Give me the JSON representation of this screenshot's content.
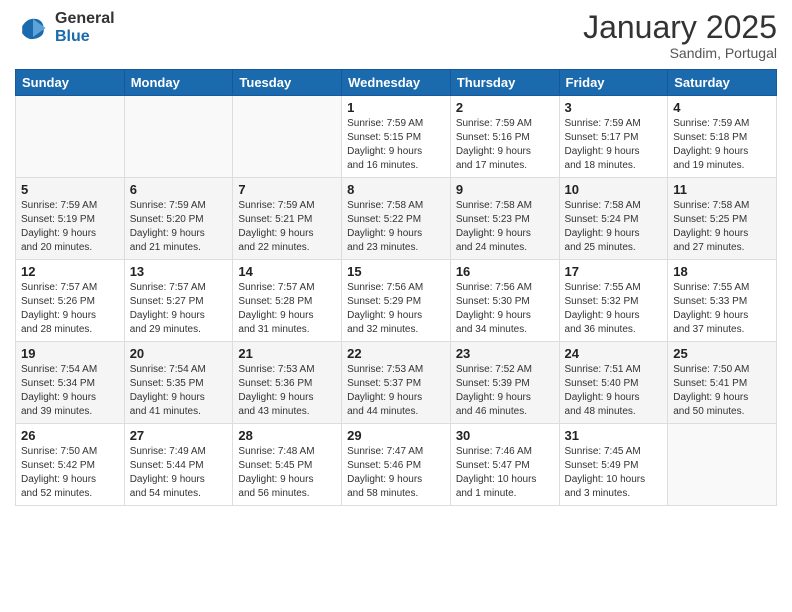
{
  "logo": {
    "general": "General",
    "blue": "Blue"
  },
  "header": {
    "month": "January 2025",
    "location": "Sandim, Portugal"
  },
  "weekdays": [
    "Sunday",
    "Monday",
    "Tuesday",
    "Wednesday",
    "Thursday",
    "Friday",
    "Saturday"
  ],
  "weeks": [
    [
      {
        "day": "",
        "info": ""
      },
      {
        "day": "",
        "info": ""
      },
      {
        "day": "",
        "info": ""
      },
      {
        "day": "1",
        "info": "Sunrise: 7:59 AM\nSunset: 5:15 PM\nDaylight: 9 hours\nand 16 minutes."
      },
      {
        "day": "2",
        "info": "Sunrise: 7:59 AM\nSunset: 5:16 PM\nDaylight: 9 hours\nand 17 minutes."
      },
      {
        "day": "3",
        "info": "Sunrise: 7:59 AM\nSunset: 5:17 PM\nDaylight: 9 hours\nand 18 minutes."
      },
      {
        "day": "4",
        "info": "Sunrise: 7:59 AM\nSunset: 5:18 PM\nDaylight: 9 hours\nand 19 minutes."
      }
    ],
    [
      {
        "day": "5",
        "info": "Sunrise: 7:59 AM\nSunset: 5:19 PM\nDaylight: 9 hours\nand 20 minutes."
      },
      {
        "day": "6",
        "info": "Sunrise: 7:59 AM\nSunset: 5:20 PM\nDaylight: 9 hours\nand 21 minutes."
      },
      {
        "day": "7",
        "info": "Sunrise: 7:59 AM\nSunset: 5:21 PM\nDaylight: 9 hours\nand 22 minutes."
      },
      {
        "day": "8",
        "info": "Sunrise: 7:58 AM\nSunset: 5:22 PM\nDaylight: 9 hours\nand 23 minutes."
      },
      {
        "day": "9",
        "info": "Sunrise: 7:58 AM\nSunset: 5:23 PM\nDaylight: 9 hours\nand 24 minutes."
      },
      {
        "day": "10",
        "info": "Sunrise: 7:58 AM\nSunset: 5:24 PM\nDaylight: 9 hours\nand 25 minutes."
      },
      {
        "day": "11",
        "info": "Sunrise: 7:58 AM\nSunset: 5:25 PM\nDaylight: 9 hours\nand 27 minutes."
      }
    ],
    [
      {
        "day": "12",
        "info": "Sunrise: 7:57 AM\nSunset: 5:26 PM\nDaylight: 9 hours\nand 28 minutes."
      },
      {
        "day": "13",
        "info": "Sunrise: 7:57 AM\nSunset: 5:27 PM\nDaylight: 9 hours\nand 29 minutes."
      },
      {
        "day": "14",
        "info": "Sunrise: 7:57 AM\nSunset: 5:28 PM\nDaylight: 9 hours\nand 31 minutes."
      },
      {
        "day": "15",
        "info": "Sunrise: 7:56 AM\nSunset: 5:29 PM\nDaylight: 9 hours\nand 32 minutes."
      },
      {
        "day": "16",
        "info": "Sunrise: 7:56 AM\nSunset: 5:30 PM\nDaylight: 9 hours\nand 34 minutes."
      },
      {
        "day": "17",
        "info": "Sunrise: 7:55 AM\nSunset: 5:32 PM\nDaylight: 9 hours\nand 36 minutes."
      },
      {
        "day": "18",
        "info": "Sunrise: 7:55 AM\nSunset: 5:33 PM\nDaylight: 9 hours\nand 37 minutes."
      }
    ],
    [
      {
        "day": "19",
        "info": "Sunrise: 7:54 AM\nSunset: 5:34 PM\nDaylight: 9 hours\nand 39 minutes."
      },
      {
        "day": "20",
        "info": "Sunrise: 7:54 AM\nSunset: 5:35 PM\nDaylight: 9 hours\nand 41 minutes."
      },
      {
        "day": "21",
        "info": "Sunrise: 7:53 AM\nSunset: 5:36 PM\nDaylight: 9 hours\nand 43 minutes."
      },
      {
        "day": "22",
        "info": "Sunrise: 7:53 AM\nSunset: 5:37 PM\nDaylight: 9 hours\nand 44 minutes."
      },
      {
        "day": "23",
        "info": "Sunrise: 7:52 AM\nSunset: 5:39 PM\nDaylight: 9 hours\nand 46 minutes."
      },
      {
        "day": "24",
        "info": "Sunrise: 7:51 AM\nSunset: 5:40 PM\nDaylight: 9 hours\nand 48 minutes."
      },
      {
        "day": "25",
        "info": "Sunrise: 7:50 AM\nSunset: 5:41 PM\nDaylight: 9 hours\nand 50 minutes."
      }
    ],
    [
      {
        "day": "26",
        "info": "Sunrise: 7:50 AM\nSunset: 5:42 PM\nDaylight: 9 hours\nand 52 minutes."
      },
      {
        "day": "27",
        "info": "Sunrise: 7:49 AM\nSunset: 5:44 PM\nDaylight: 9 hours\nand 54 minutes."
      },
      {
        "day": "28",
        "info": "Sunrise: 7:48 AM\nSunset: 5:45 PM\nDaylight: 9 hours\nand 56 minutes."
      },
      {
        "day": "29",
        "info": "Sunrise: 7:47 AM\nSunset: 5:46 PM\nDaylight: 9 hours\nand 58 minutes."
      },
      {
        "day": "30",
        "info": "Sunrise: 7:46 AM\nSunset: 5:47 PM\nDaylight: 10 hours\nand 1 minute."
      },
      {
        "day": "31",
        "info": "Sunrise: 7:45 AM\nSunset: 5:49 PM\nDaylight: 10 hours\nand 3 minutes."
      },
      {
        "day": "",
        "info": ""
      }
    ]
  ]
}
